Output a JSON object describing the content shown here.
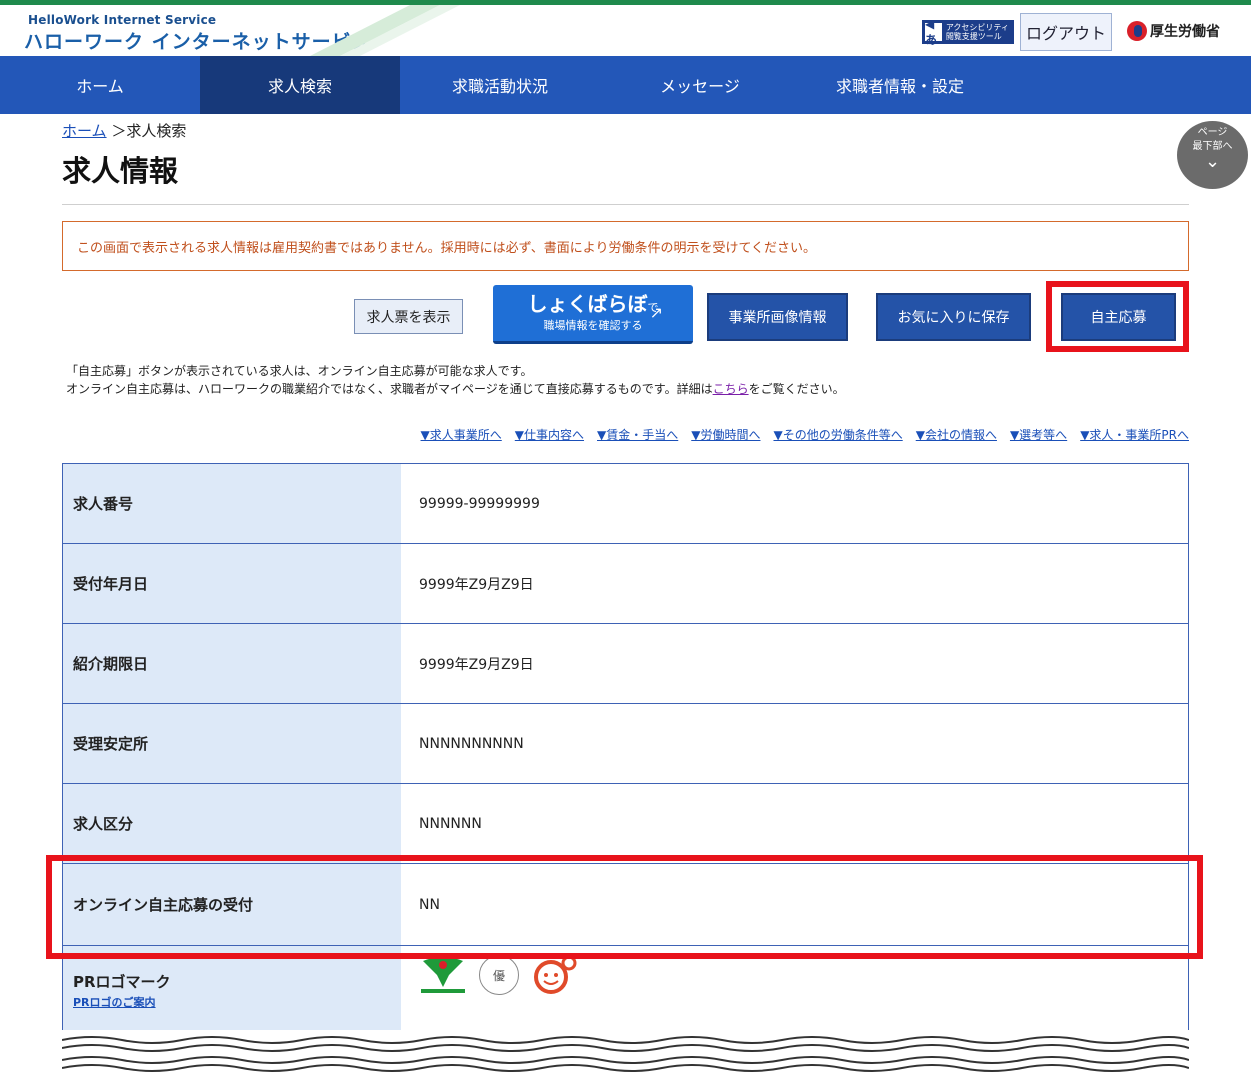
{
  "header": {
    "logo_sub": "HelloWork Internet Service",
    "logo_main": "ハローワーク インターネットサービス",
    "accessibility_label": "アクセシビリティ 閲覧支援ツール",
    "logout": "ログアウト",
    "ministry": "厚生労働省"
  },
  "nav": {
    "items": [
      "ホーム",
      "求人検索",
      "求職活動状況",
      "メッセージ",
      "求職者情報・設定"
    ],
    "active_index": 1
  },
  "breadcrumb": {
    "home": "ホーム",
    "sep": " ＞",
    "current": "求人検索"
  },
  "page_title": "求人情報",
  "scroll_button": {
    "line1": "ページ",
    "line2": "最下部へ"
  },
  "notice": "この画面で表示される求人情報は雇用契約書ではありません。採用時には必ず、書面により労働条件の明示を受けてください。",
  "buttons": {
    "show_ticket": "求人票を表示",
    "shokuba_main": "しょくばらぼ",
    "shokuba_de": "で",
    "shokuba_sub": "職場情報を確認する",
    "office_images": "事業所画像情報",
    "save_favorite": "お気に入りに保存",
    "self_apply": "自主応募"
  },
  "note": {
    "line1": "「自主応募」ボタンが表示されている求人は、オンライン自主応募が可能な求人です。",
    "line2_pre": "オンライン自主応募は、ハローワークの職業紹介ではなく、求職者がマイページを通じて直接応募するものです。詳細は",
    "line2_link": "こちら",
    "line2_post": "をご覧ください。"
  },
  "anchors": [
    "▼求人事業所へ",
    "▼仕事内容へ",
    "▼賃金・手当へ",
    "▼労働時間へ",
    "▼その他の労働条件等へ",
    "▼会社の情報へ",
    "▼選考等へ",
    "▼求人・事業所PRへ"
  ],
  "table": {
    "rows": [
      {
        "label": "求人番号",
        "value": "99999-99999999"
      },
      {
        "label": "受付年月日",
        "value": "9999年Z9月Z9日"
      },
      {
        "label": "紹介期限日",
        "value": "9999年Z9月Z9日"
      },
      {
        "label": "受理安定所",
        "value": "NNNNNNNNNN"
      },
      {
        "label": "求人区分",
        "value": "NNNNNN"
      },
      {
        "label": "オンライン自主応募の受付",
        "value": "NN"
      }
    ],
    "pr_label": "PRロゴマーク",
    "pr_link": "PRロゴのご案内",
    "pr_logo_b_text": "優"
  },
  "colors": {
    "nav": "#2357b8",
    "nav_active": "#17397a",
    "highlight": "#e8131b",
    "notice": "#c0501d"
  }
}
